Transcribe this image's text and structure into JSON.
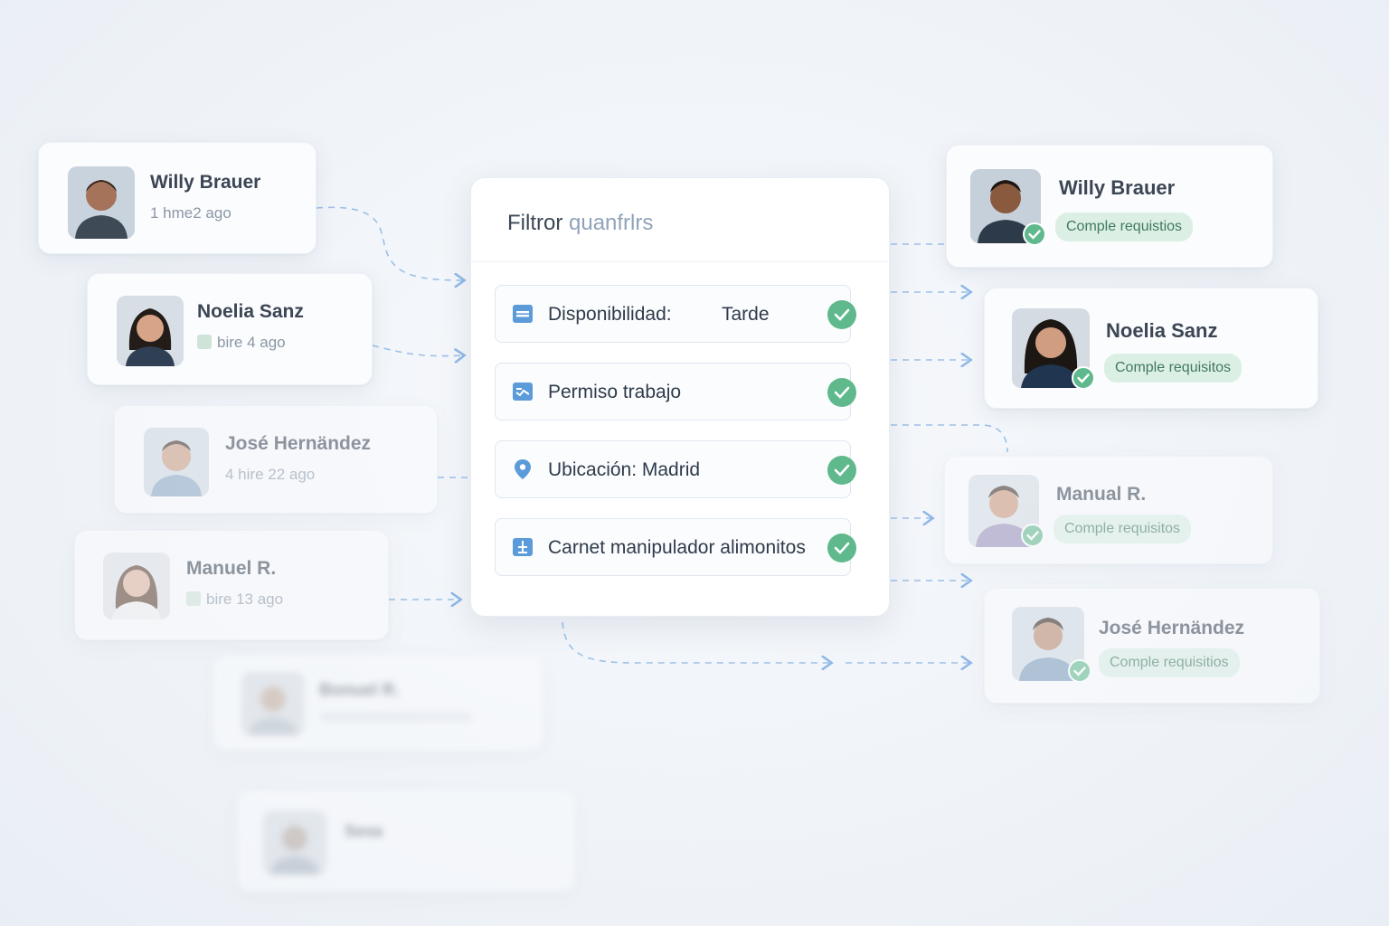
{
  "filter_panel": {
    "title_main": "Filtror",
    "title_light": "quanfrlrs",
    "criteria": [
      {
        "icon": "calendar-icon",
        "label": "Disponibilidad:",
        "value": "Tarde"
      },
      {
        "icon": "work-permit-icon",
        "label": "Permiso trabajo",
        "value": ""
      },
      {
        "icon": "location-pin-icon",
        "label": "Ubicación: Madrid",
        "value": ""
      },
      {
        "icon": "certificate-icon",
        "label": "Carnet manipulador alimonitos",
        "value": ""
      }
    ]
  },
  "candidates_in": [
    {
      "name": "Willy Brauer",
      "time": "1 hme2 ago"
    },
    {
      "name": "Noelia Sanz",
      "time": "bire 4 ago"
    },
    {
      "name": "José Hernändez",
      "time": "4 hire 22 ago"
    },
    {
      "name": "Manuel R.",
      "time": "bire 13 ago"
    },
    {
      "name": "Bonuel R.",
      "time": ""
    },
    {
      "name": "Sesa",
      "time": ""
    }
  ],
  "candidates_out": [
    {
      "name": "Willy Brauer",
      "status": "Comple requistios"
    },
    {
      "name": "Noelia Sanz",
      "status": "Comple requisitos"
    },
    {
      "name": "Manual R.",
      "status": "Comple requisitos"
    },
    {
      "name": "José Hernändez",
      "status": "Comple requisitios"
    }
  ],
  "colors": {
    "accent_blue": "#5b9bd9",
    "check_green": "#5fb98c",
    "pill_bg": "#dcefe5",
    "pill_text": "#3f7a5c"
  }
}
